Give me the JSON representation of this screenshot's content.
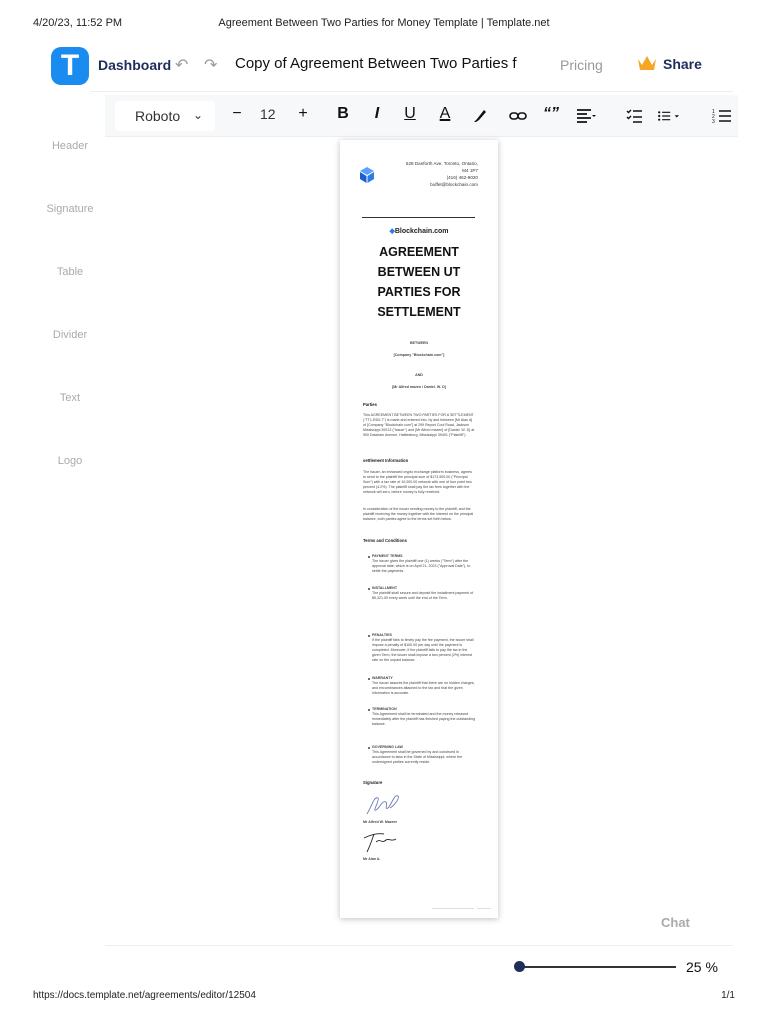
{
  "print": {
    "timestamp": "4/20/23, 11:52 PM",
    "title": "Agreement Between Two Parties for Money Template | Template.net",
    "url": "https://docs.template.net/agreements/editor/12504",
    "page": "1/1"
  },
  "topbar": {
    "logo_letter": "T",
    "dashboard": "Dashboard",
    "doc_title": "Copy of Agreement Between Two Parties for Money",
    "pricing": "Pricing",
    "share": "Share"
  },
  "toolbar": {
    "font": "Roboto",
    "font_size": "12",
    "minus": "−",
    "plus": "+",
    "bold": "B",
    "italic": "I",
    "underline": "U",
    "color": "A"
  },
  "sidebar": {
    "items": [
      "Header",
      "Signature",
      "Table",
      "Divider",
      "Text",
      "Logo"
    ]
  },
  "document": {
    "address": [
      "528 Danforth Ave, Toronto, Ontario,",
      "M4 1P7",
      "(416) 462-9020",
      "buffet@blockchain.com"
    ],
    "brand": "Blockchain.com",
    "title": "AGREEMENT BETWEEN UT PARTIES FOR SETTLEMENT",
    "between": "BETWEEN",
    "party1": "[Company \"Blockchain.com\"]",
    "and": "AND",
    "party2": "[Mr Alfred mazen / Daniel. W. D]",
    "parties_head": "Parties",
    "parties_text": "This AGREEMENT BETWEEN TWO PARTIES FOR A SETTLEMENT (\"TT1-RD0-7\") is made and entered into, by and between [Mr Alan A] of [Company \"Blockchain.com\"] at 299 Report Cool Road, Jackson Mississippi 39213 (\"Issuer\") and [Mr Alfred mazen] of [Daniel. W. D] at 900 Dawham Avenue, Hattiesburg, Mississippi 39401 (\"Plaintiff\").",
    "settlement_head": "settlement Information",
    "settlement_text": "The issuer, an enhanced crypto exchange platform business, agrees to send to the plaintiff the principal sum of $173,900.00 (\"Principal Sum\") with a tax rate of 10,000.00 network with one of four point two percent (4.2%). The plaintiff shall pay the tax fees together with the network will zero, before money is fully received.",
    "consideration_text": "In consideration of the issuer sending money to the plaintiff, and the plaintiff receiving the money together with the interest on the principal balance, both parties agree to the terms set forth below.",
    "terms_head": "Terms and Conditions",
    "terms": [
      {
        "head": "PAYMENT TERMS",
        "text": "The issuer gives the plaintiff one (1) weeks (\"Term\") after the approval date, which is on April 21, 2023 (\"Approval Date\"), to settle the payments."
      },
      {
        "head": "INSTALLMENT",
        "text": "The plaintiff shall secure and deposit the installment payment of $5,321.00 every week until the end of the Term."
      },
      {
        "head": "PENALTIES",
        "text": "If the plaintiff fails to timely pay the fee payment, the issuer shall impose a penalty of $100.00 per day until the payment is completed. Moreover, if the plaintiff fails to pay the tax in the given Term, the issuer shall impose a two percent (2%) interest rate on the unpaid balance."
      },
      {
        "head": "WARRANTY",
        "text": "The issuer assures the plaintiff that there are no hidden charges, and encumbrances attached to the tax and that the given information is accurate."
      },
      {
        "head": "TERMINATION",
        "text": "This Agreement shall be terminated and the money released immediately after the plaintiff has finished paying the outstanding balance."
      },
      {
        "head": "GOVERNING LAW",
        "text": "This Agreement shall be governed by and construed in accordance to laws in the State of Mississippi, where the undersigned parties currently reside."
      }
    ],
    "signature_head": "Signature",
    "signer1": "Mr Alfred W. Mazeer",
    "signer2": "Mr Alan A."
  },
  "chat": "Chat",
  "zoom": {
    "label": "25 %",
    "level_percent": 25
  },
  "colors": {
    "brand_blue": "#1a8cf0",
    "navy": "#1f2d5a",
    "crown": "#f5a623"
  }
}
